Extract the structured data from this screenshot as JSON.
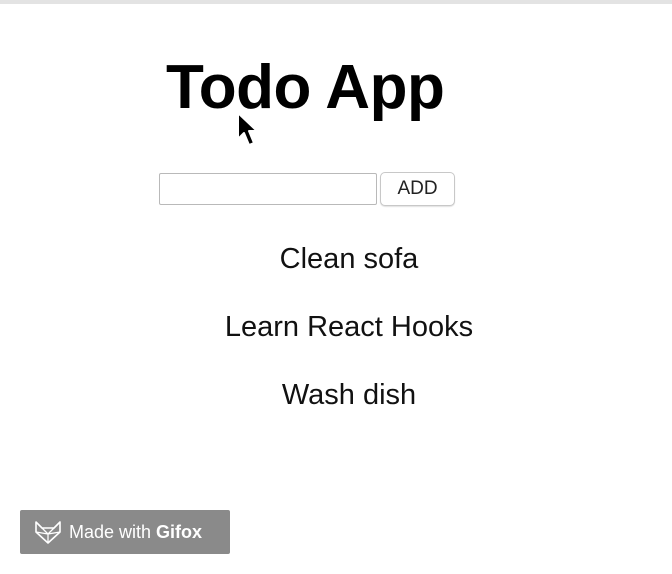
{
  "app": {
    "title": "Todo App"
  },
  "form": {
    "input_value": "",
    "input_placeholder": "",
    "add_label": "ADD"
  },
  "todos": [
    {
      "label": "Clean sofa"
    },
    {
      "label": "Learn React Hooks"
    },
    {
      "label": "Wash dish"
    }
  ],
  "watermark": {
    "text": "Made with",
    "brand": "Gifox",
    "icon": "fox-icon"
  },
  "cursor": {
    "icon": "mouse-pointer-icon"
  }
}
